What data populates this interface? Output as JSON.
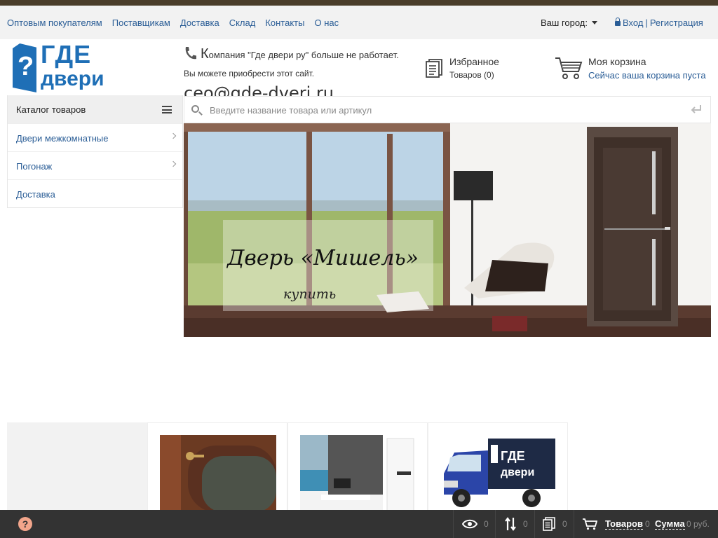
{
  "top_nav": {
    "links": [
      "Оптовым покупателям",
      "Поставщикам",
      "Доставка",
      "Склад",
      "Контакты",
      "О нас"
    ],
    "city_label": "Ваш город:",
    "login": "Вход",
    "separator": "|",
    "register": "Регистрация"
  },
  "logo": {
    "glyph": "?",
    "line1": "ГДЕ",
    "line2": "двери"
  },
  "notice": {
    "first_letter": "К",
    "line1_rest": "омпания \"Где двери ру\" больше не работает.",
    "line2": "Вы можете приобрести этот сайт.",
    "email": "ceo@gde-dveri.ru"
  },
  "favorites": {
    "title": "Избранное",
    "count_text": "Товаров (0)"
  },
  "cart": {
    "title": "Моя корзина",
    "status": "Сейчас ваша корзина пуста"
  },
  "catalog": {
    "header": "Каталог товаров",
    "items": [
      {
        "label": "Двери межкомнатные",
        "has_children": true
      },
      {
        "label": "Погонаж",
        "has_children": true
      },
      {
        "label": "Доставка",
        "has_children": false
      }
    ]
  },
  "search": {
    "placeholder": "Введите название товара или артикул"
  },
  "banner": {
    "title": "Дверь «Мишель»",
    "cta": "купить"
  },
  "bottom_bar": {
    "help_glyph": "?",
    "viewed_count": "0",
    "compare_count": "0",
    "favorites_count": "0",
    "goods_label": "Товаров",
    "goods_count": "0",
    "sum_label": "Сумма",
    "sum_value": "0 руб."
  },
  "colors": {
    "brand_blue": "#1f6fb6",
    "link_blue": "#2a5d96",
    "top_stripe": "#4a3d2a",
    "bottom_bar": "#333333",
    "help_accent": "#f2a58b"
  }
}
